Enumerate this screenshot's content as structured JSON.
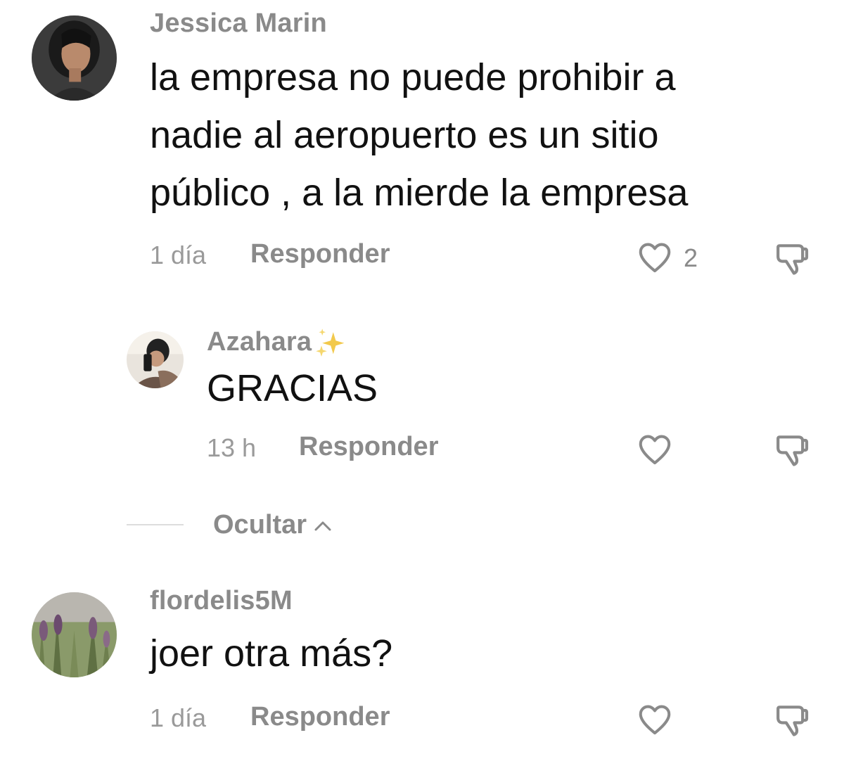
{
  "comments": [
    {
      "username": "Jessica Marin",
      "text_lines": [
        "la empresa no puede prohibir a",
        "nadie al aeropuerto es un sitio",
        "público , a la mierde la empresa"
      ],
      "time": "1 día",
      "reply_label": "Responder",
      "like_count": "2",
      "like_icon": "heart-outline-icon",
      "dislike_icon": "thumbs-down-icon"
    },
    {
      "username": "Azahara",
      "username_emoji": "sparkles-icon",
      "text": "GRACIAS",
      "time": "13 h",
      "reply_label": "Responder",
      "like_icon": "heart-outline-icon",
      "dislike_icon": "thumbs-down-icon"
    },
    {
      "username": "flordelis5M",
      "text": "joer otra más?",
      "time": "1 día",
      "reply_label": "Responder",
      "like_icon": "heart-outline-icon",
      "dislike_icon": "thumbs-down-icon"
    }
  ],
  "replies_toggle": {
    "label": "Ocultar",
    "icon": "chevron-up-icon"
  },
  "colors": {
    "text": "#111111",
    "muted": "#8a8a8a",
    "time": "#9a9a9a",
    "icon_stroke": "#8a8a8a",
    "sparkle": "#f2c94c",
    "divider": "#dddddd"
  }
}
